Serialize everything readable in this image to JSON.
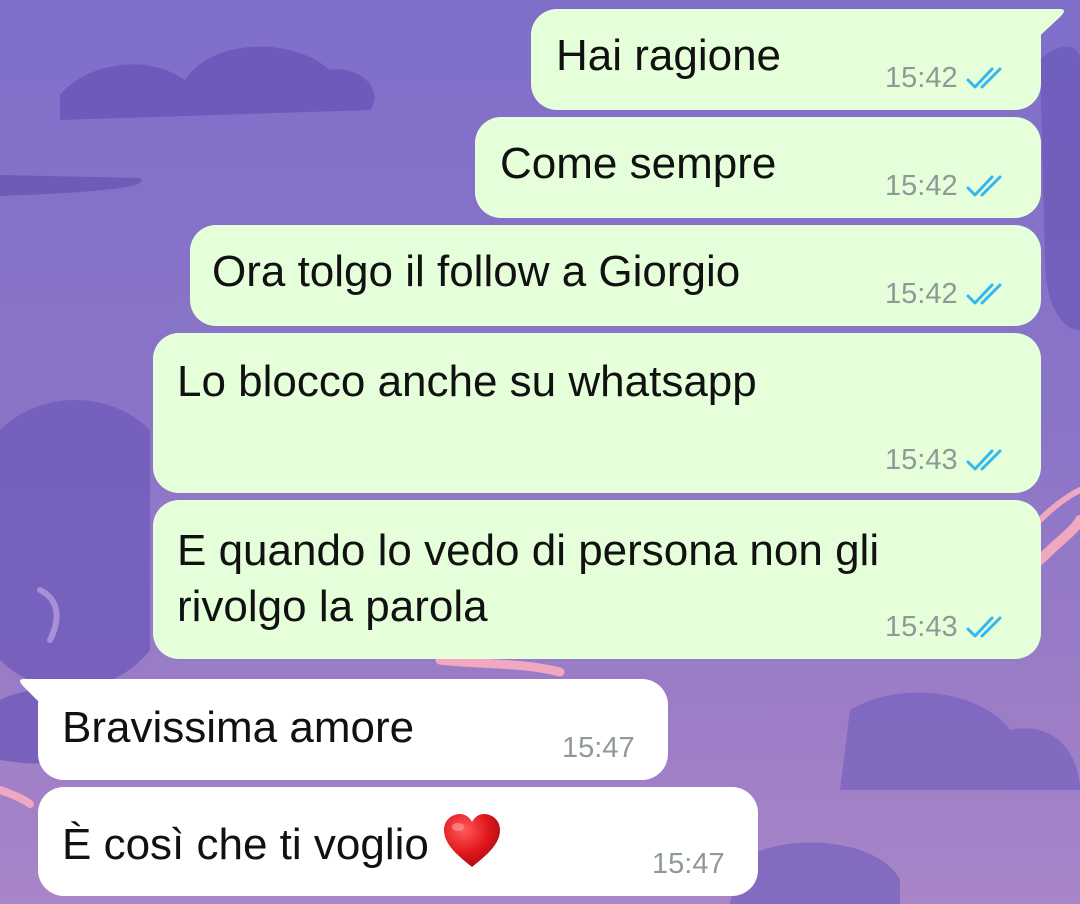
{
  "colors": {
    "outgoing_bubble": "#e6ffdb",
    "incoming_bubble": "#ffffff",
    "read_ticks": "#34b7f1",
    "timestamp": "#8f9a96"
  },
  "messages": [
    {
      "direction": "outgoing",
      "text": "Hai ragione",
      "time": "15:42",
      "status": "read-double-check-icon"
    },
    {
      "direction": "outgoing",
      "text": "Come sempre",
      "time": "15:42",
      "status": "read-double-check-icon"
    },
    {
      "direction": "outgoing",
      "text": "Ora tolgo il follow a Giorgio",
      "time": "15:42",
      "status": "read-double-check-icon"
    },
    {
      "direction": "outgoing",
      "text": "Lo blocco anche su whatsapp",
      "time": "15:43",
      "status": "read-double-check-icon"
    },
    {
      "direction": "outgoing",
      "text_line1": "E quando lo vedo di persona non gli",
      "text_line2": "rivolgo la parola",
      "time": "15:43",
      "status": "read-double-check-icon"
    },
    {
      "direction": "incoming",
      "text": "Bravissima amore",
      "time": "15:47"
    },
    {
      "direction": "incoming",
      "text": "È così che ti voglio",
      "emoji": "red-heart-emoji",
      "time": "15:47"
    }
  ]
}
